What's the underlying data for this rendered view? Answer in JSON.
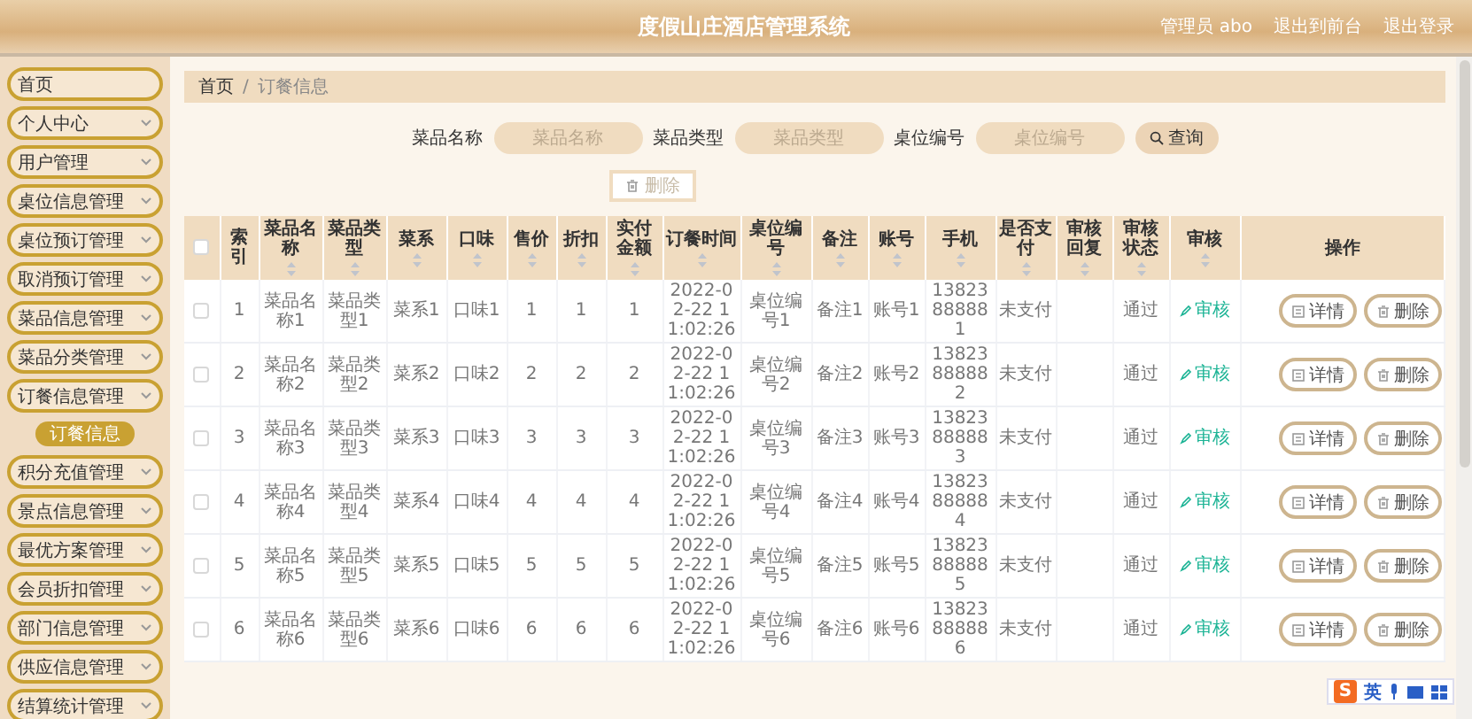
{
  "header": {
    "title": "度假山庄酒店管理系统",
    "links": [
      "管理员 abo",
      "退出到前台",
      "退出登录"
    ]
  },
  "sidebar": {
    "items": [
      {
        "label": "首页",
        "kind": "link"
      },
      {
        "label": "个人中心",
        "kind": "menu"
      },
      {
        "label": "用户管理",
        "kind": "menu"
      },
      {
        "label": "桌位信息管理",
        "kind": "menu"
      },
      {
        "label": "桌位预订管理",
        "kind": "menu"
      },
      {
        "label": "取消预订管理",
        "kind": "menu"
      },
      {
        "label": "菜品信息管理",
        "kind": "menu"
      },
      {
        "label": "菜品分类管理",
        "kind": "menu"
      },
      {
        "label": "订餐信息管理",
        "kind": "menu",
        "children": [
          {
            "label": "订餐信息",
            "selected": true
          }
        ]
      },
      {
        "label": "积分充值管理",
        "kind": "menu"
      },
      {
        "label": "景点信息管理",
        "kind": "menu"
      },
      {
        "label": "最优方案管理",
        "kind": "menu"
      },
      {
        "label": "会员折扣管理",
        "kind": "menu"
      },
      {
        "label": "部门信息管理",
        "kind": "menu"
      },
      {
        "label": "供应信息管理",
        "kind": "menu"
      },
      {
        "label": "结算统计管理",
        "kind": "menu"
      }
    ]
  },
  "breadcrumb": [
    "首页",
    "/",
    "订餐信息"
  ],
  "search": {
    "fields": [
      {
        "label": "菜品名称",
        "placeholder": "菜品名称"
      },
      {
        "label": "菜品类型",
        "placeholder": "菜品类型"
      },
      {
        "label": "桌位编号",
        "placeholder": "桌位编号"
      }
    ],
    "button": "查询"
  },
  "delete_button": {
    "label": "删除",
    "disabled": true
  },
  "table": {
    "select_all": {
      "checked": false
    },
    "columns": [
      {
        "label": "索引",
        "sortable": false,
        "kind": "text"
      },
      {
        "label": "菜品名称",
        "sortable": true,
        "kind": "text"
      },
      {
        "label": "菜品类型",
        "sortable": true,
        "kind": "text"
      },
      {
        "label": "菜系",
        "sortable": true,
        "kind": "text"
      },
      {
        "label": "口味",
        "sortable": true,
        "kind": "text"
      },
      {
        "label": "售价",
        "sortable": true,
        "kind": "text"
      },
      {
        "label": "折扣",
        "sortable": true,
        "kind": "text"
      },
      {
        "label": "实付金额",
        "sortable": true,
        "kind": "text"
      },
      {
        "label": "订餐时间",
        "sortable": true,
        "kind": "text"
      },
      {
        "label": "桌位编号",
        "sortable": true,
        "kind": "text"
      },
      {
        "label": "备注",
        "sortable": true,
        "kind": "text"
      },
      {
        "label": "账号",
        "sortable": true,
        "kind": "text"
      },
      {
        "label": "手机",
        "sortable": true,
        "kind": "text"
      },
      {
        "label": "是否支付",
        "sortable": true,
        "kind": "text"
      },
      {
        "label": "审核回复",
        "sortable": true,
        "kind": "text"
      },
      {
        "label": "审核状态",
        "sortable": true,
        "kind": "text"
      },
      {
        "label": "审核",
        "sortable": true,
        "kind": "link"
      },
      {
        "label": "操作",
        "sortable": false,
        "kind": "actions"
      }
    ],
    "rows": [
      {
        "checked": false,
        "cells": [
          "1",
          "菜品名称1",
          "菜品类型1",
          "菜系1",
          "口味1",
          "1",
          "1",
          "1",
          "2022-02-22 11:02:26",
          "桌位编号1",
          "备注1",
          "账号1",
          "13823888881",
          "未支付",
          null,
          "通过",
          "审核",
          [
            "详情",
            "删除"
          ]
        ]
      },
      {
        "checked": false,
        "cells": [
          "2",
          "菜品名称2",
          "菜品类型2",
          "菜系2",
          "口味2",
          "2",
          "2",
          "2",
          "2022-02-22 11:02:26",
          "桌位编号2",
          "备注2",
          "账号2",
          "13823888882",
          "未支付",
          null,
          "通过",
          "审核",
          [
            "详情",
            "删除"
          ]
        ]
      },
      {
        "checked": false,
        "cells": [
          "3",
          "菜品名称3",
          "菜品类型3",
          "菜系3",
          "口味3",
          "3",
          "3",
          "3",
          "2022-02-22 11:02:26",
          "桌位编号3",
          "备注3",
          "账号3",
          "13823888883",
          "未支付",
          null,
          "通过",
          "审核",
          [
            "详情",
            "删除"
          ]
        ]
      },
      {
        "checked": false,
        "cells": [
          "4",
          "菜品名称4",
          "菜品类型4",
          "菜系4",
          "口味4",
          "4",
          "4",
          "4",
          "2022-02-22 11:02:26",
          "桌位编号4",
          "备注4",
          "账号4",
          "13823888884",
          "未支付",
          null,
          "通过",
          "审核",
          [
            "详情",
            "删除"
          ]
        ]
      },
      {
        "checked": false,
        "cells": [
          "5",
          "菜品名称5",
          "菜品类型5",
          "菜系5",
          "口味5",
          "5",
          "5",
          "5",
          "2022-02-22 11:02:26",
          "桌位编号5",
          "备注5",
          "账号5",
          "13823888885",
          "未支付",
          null,
          "通过",
          "审核",
          [
            "详情",
            "删除"
          ]
        ]
      },
      {
        "checked": false,
        "cells": [
          "6",
          "菜品名称6",
          "菜品类型6",
          "菜系6",
          "口味6",
          "6",
          "6",
          "6",
          "2022-02-22 11:02:26",
          "桌位编号6",
          "备注6",
          "账号6",
          "13823888886",
          "未支付",
          null,
          "通过",
          "审核",
          [
            "详情",
            "删除"
          ]
        ]
      }
    ]
  },
  "ime": {
    "logo": "S",
    "mode": "英"
  }
}
